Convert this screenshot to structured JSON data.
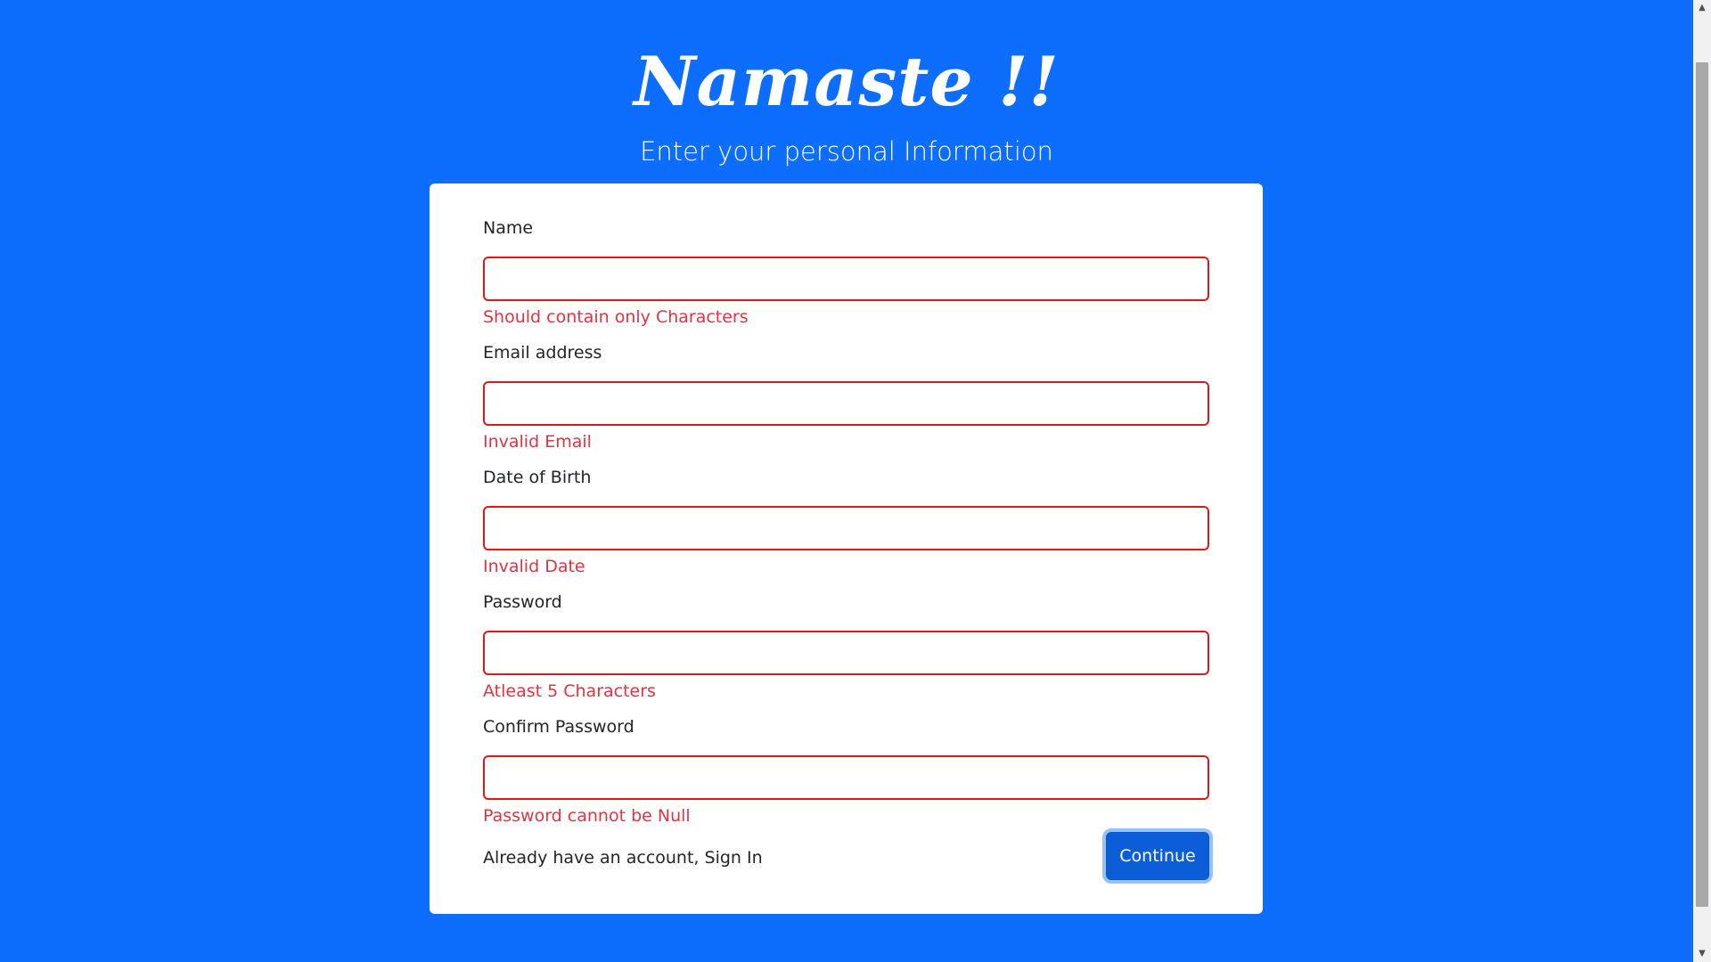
{
  "header": {
    "brand": "Namaste !!",
    "subtitle": "Enter your personal Information"
  },
  "form": {
    "fields": [
      {
        "label": "Name",
        "value": "",
        "error": "Should contain only Characters"
      },
      {
        "label": "Email address",
        "value": "",
        "error": "Invalid Email"
      },
      {
        "label": "Date of Birth",
        "value": "",
        "error": "Invalid Date"
      },
      {
        "label": "Password",
        "value": "",
        "error": "Atleast 5 Characters"
      },
      {
        "label": "Confirm Password",
        "value": "",
        "error": "Password cannot be Null"
      }
    ],
    "signin_text": "Already have an account, Sign In",
    "continue_label": "Continue"
  },
  "colors": {
    "background": "#0d6efd",
    "card": "#ffffff",
    "error": "#dc3545",
    "button": "#0b5ed7"
  },
  "scrollbar": {
    "up_icon": "scroll-up-arrow-icon",
    "down_icon": "scroll-down-arrow-icon"
  }
}
